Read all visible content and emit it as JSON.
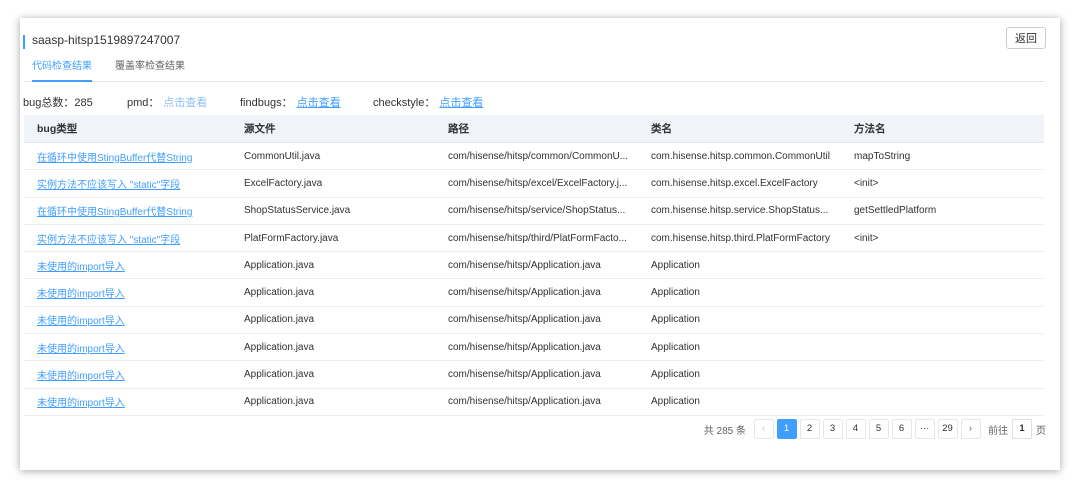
{
  "header": {
    "title": "saasp-hitsp1519897247007",
    "back_label": "返回"
  },
  "tabs": [
    {
      "label": "代码检查结果",
      "active": true
    },
    {
      "label": "覆盖率检查结果",
      "active": false
    }
  ],
  "stats": {
    "bug_total_label": "bug总数：285",
    "pmd_label": "pmd：",
    "pmd_link": "点击查看",
    "findbugs_label": "findbugs：",
    "findbugs_link": "点击查看",
    "checkstyle_label": "checkstyle：",
    "checkstyle_link": "点击查看"
  },
  "table": {
    "columns": [
      "bug类型",
      "源文件",
      "路径",
      "类名",
      "方法名"
    ],
    "rows": [
      {
        "bug": "在循环中使用StingBuffer代替String",
        "file": "CommonUtil.java",
        "path": "com/hisense/hitsp/common/CommonU...",
        "class": "com.hisense.hitsp.common.CommonUtil",
        "method": "mapToString"
      },
      {
        "bug": "实例方法不应该写入 \"static\"字段",
        "file": "ExcelFactory.java",
        "path": "com/hisense/hitsp/excel/ExcelFactory.j...",
        "class": "com.hisense.hitsp.excel.ExcelFactory",
        "method": "<init>"
      },
      {
        "bug": "在循环中使用StingBuffer代替String",
        "file": "ShopStatusService.java",
        "path": "com/hisense/hitsp/service/ShopStatus...",
        "class": "com.hisense.hitsp.service.ShopStatus...",
        "method": "getSettledPlatform"
      },
      {
        "bug": "实例方法不应该写入 \"static\"字段",
        "file": "PlatFormFactory.java",
        "path": "com/hisense/hitsp/third/PlatFormFacto...",
        "class": "com.hisense.hitsp.third.PlatFormFactory",
        "method": "<init>"
      },
      {
        "bug": "未使用的import导入",
        "file": "Application.java",
        "path": "com/hisense/hitsp/Application.java",
        "class": "Application",
        "method": ""
      },
      {
        "bug": "未使用的import导入",
        "file": "Application.java",
        "path": "com/hisense/hitsp/Application.java",
        "class": "Application",
        "method": ""
      },
      {
        "bug": "未使用的import导入",
        "file": "Application.java",
        "path": "com/hisense/hitsp/Application.java",
        "class": "Application",
        "method": ""
      },
      {
        "bug": "未使用的import导入",
        "file": "Application.java",
        "path": "com/hisense/hitsp/Application.java",
        "class": "Application",
        "method": ""
      },
      {
        "bug": "未使用的import导入",
        "file": "Application.java",
        "path": "com/hisense/hitsp/Application.java",
        "class": "Application",
        "method": ""
      },
      {
        "bug": "未使用的import导入",
        "file": "Application.java",
        "path": "com/hisense/hitsp/Application.java",
        "class": "Application",
        "method": ""
      }
    ]
  },
  "pagination": {
    "total_label": "共 285 条",
    "prev_icon": "‹",
    "next_icon": "›",
    "pages": [
      "1",
      "2",
      "3",
      "4",
      "5",
      "6",
      "···",
      "29"
    ],
    "current": "1",
    "goto_label": "前往",
    "goto_value": "1",
    "unit_label": "页"
  },
  "colors": {
    "accent": "#409eff",
    "header_bg": "#f0f3f7"
  }
}
